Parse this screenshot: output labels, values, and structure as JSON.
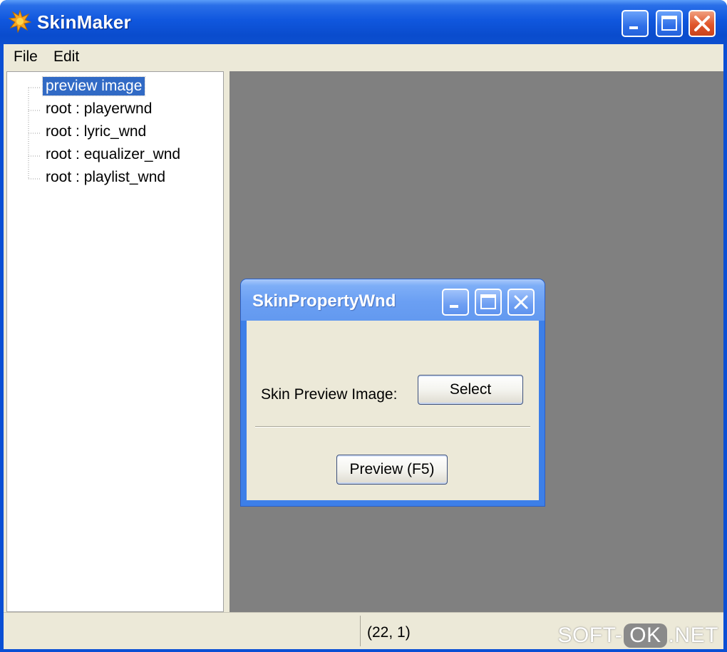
{
  "window": {
    "title": "SkinMaker",
    "app_icon": "star-burst-icon",
    "controls": {
      "minimize": "minimize-icon",
      "maximize": "maximize-icon",
      "close": "close-icon"
    }
  },
  "menu": {
    "items": [
      {
        "label": "File"
      },
      {
        "label": "Edit"
      }
    ]
  },
  "tree": {
    "items": [
      {
        "label": "preview image",
        "selected": true
      },
      {
        "label": "root : playerwnd",
        "selected": false
      },
      {
        "label": "root : lyric_wnd",
        "selected": false
      },
      {
        "label": "root : equalizer_wnd",
        "selected": false
      },
      {
        "label": "root : playlist_wnd",
        "selected": false
      }
    ]
  },
  "dialog": {
    "title": "SkinPropertyWnd",
    "preview_image_label": "Skin Preview Image:",
    "select_button": "Select",
    "preview_button": "Preview (F5)"
  },
  "statusbar": {
    "position": "(22, 1)"
  },
  "watermark": {
    "left": "SOFT-",
    "badge": "OK",
    "right": ".NET"
  },
  "colors": {
    "titlebar": "#0a4fd4",
    "selection": "#316ac5",
    "canvas": "#808080",
    "face": "#ece9d8"
  }
}
